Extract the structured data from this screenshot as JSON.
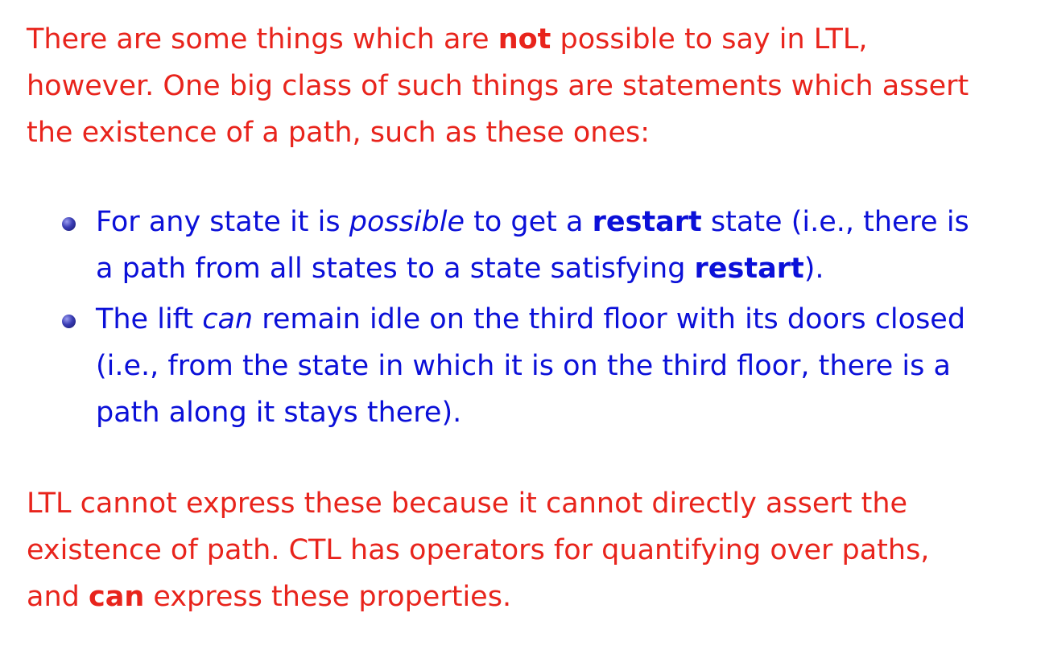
{
  "intro": {
    "line1_pre": "There are some things which are ",
    "line1_bold": "not",
    "line1_post": " possible to say in LTL,",
    "line2": "however. One big class of such things are statements which assert",
    "line3": "the existence of a path, such as these ones:"
  },
  "bullets": [
    {
      "line1_a": "For any state it is ",
      "line1_italic": "possible",
      "line1_b": " to get a ",
      "line1_bold": "restart",
      "line1_c": " state (i.e., there is",
      "line2_a": "a path from all states to a state satisfying ",
      "line2_bold": "restart",
      "line2_b": ")."
    },
    {
      "line1_a": "The lift ",
      "line1_italic": "can",
      "line1_b": " remain idle on the third floor with its doors closed",
      "line2": "(i.e., from the state in which it is on the third floor, there is a",
      "line3": "path along it stays there)."
    }
  ],
  "conclusion": {
    "line1": "LTL cannot express these because it cannot directly assert the",
    "line2": "existence of path. CTL has operators for quantifying over paths,",
    "line3_pre": "and ",
    "line3_bold": "can",
    "line3_post": " express these properties."
  },
  "colors": {
    "text_red": "#e8241c",
    "text_blue": "#0b10d8"
  }
}
